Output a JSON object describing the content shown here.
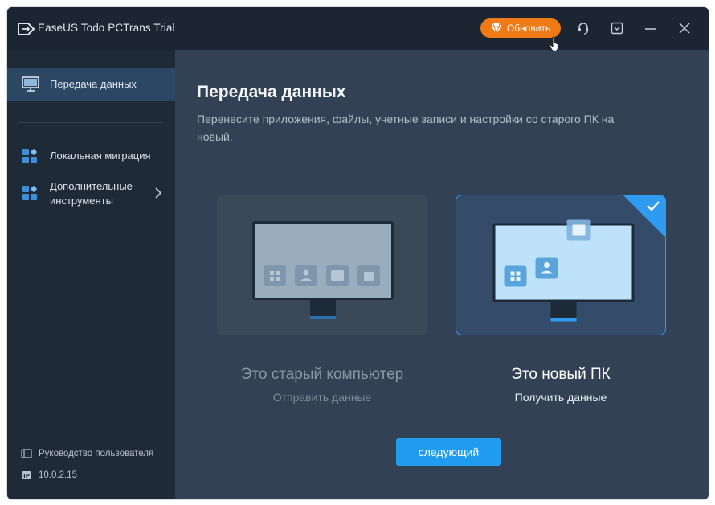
{
  "titlebar": {
    "app_title": "EaseUS Todo PCTrans Trial",
    "upgrade_label": "Обновить",
    "upgrade_color": "#f07a16",
    "icons": [
      "app-logo-icon",
      "gem-icon",
      "support-icon",
      "menu-dropdown-icon",
      "minimize-icon",
      "close-icon"
    ]
  },
  "sidebar": {
    "items": [
      {
        "label": "Передача данных",
        "icon": "monitor-icon",
        "active": true
      },
      {
        "label": "Локальная миграция",
        "icon": "apps-grid-icon",
        "active": false
      },
      {
        "label": "Дополнительные инструменты",
        "icon": "tools-grid-icon",
        "active": false
      }
    ],
    "footer": {
      "guide_label": "Руководство пользователя",
      "version_label": "10.0.2.15"
    }
  },
  "main": {
    "title": "Передача данных",
    "subtitle": "Перенесите приложения, файлы, учетные записи и настройки со старого ПК на новый.",
    "cards": [
      {
        "title": "Это старый компьютер",
        "subtitle": "Отправить данные",
        "selected": false
      },
      {
        "title": "Это новый ПК",
        "subtitle": "Получить данные",
        "selected": true
      }
    ],
    "next_label": "следующий",
    "accent_color": "#1f9bf0"
  }
}
